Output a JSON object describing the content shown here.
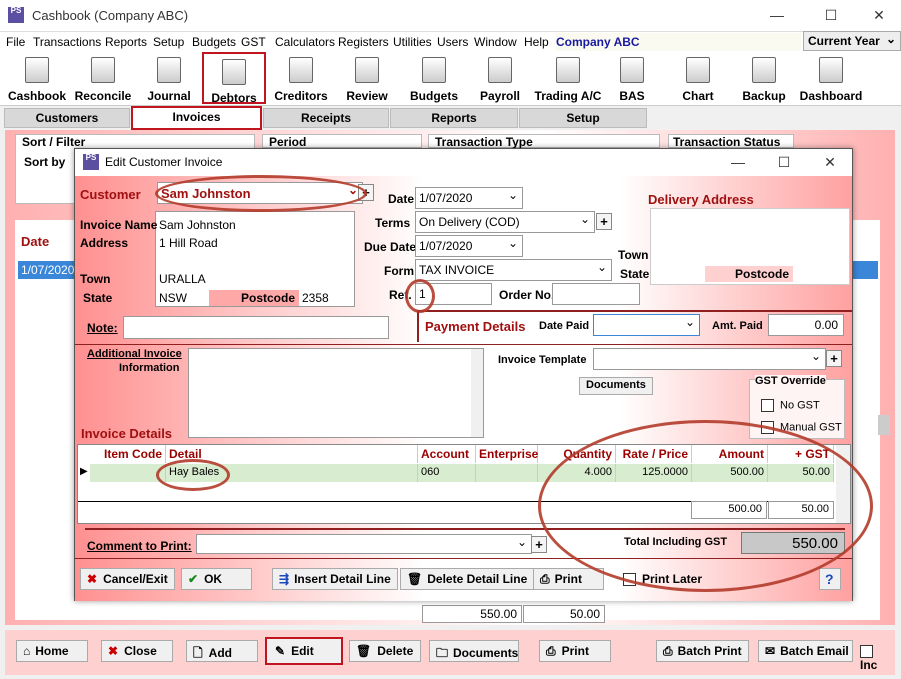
{
  "window": {
    "title": "Cashbook (Company ABC)",
    "logo": "PS"
  },
  "menu": [
    "File",
    "Transactions",
    "Reports",
    "Setup",
    "Budgets",
    "GST",
    "Calculators",
    "Registers",
    "Utilities",
    "Users",
    "Window",
    "Help"
  ],
  "company": "Company ABC",
  "year": "Current Year",
  "toolbar": [
    "Cashbook",
    "Reconcile",
    "Journal",
    "Debtors",
    "Creditors",
    "Review",
    "Budgets",
    "Payroll",
    "Trading A/C",
    "BAS",
    "Chart",
    "Backup",
    "Dashboard"
  ],
  "tabs": [
    "Customers",
    "Invoices",
    "Receipts",
    "Reports",
    "Setup"
  ],
  "bg": {
    "sort_filter": "Sort / Filter",
    "sort_by": "Sort by",
    "period": "Period",
    "transaction_type": "Transaction Type",
    "transaction_status": "Transaction Status",
    "date_header": "Date",
    "row_date": "1/07/2020",
    "total_amount": "550.00",
    "total_gst": "50.00"
  },
  "dialog": {
    "title": "Edit Customer Invoice",
    "customer_label": "Customer",
    "customer": "Sam Johnston",
    "invoice_name_label": "Invoice Name",
    "invoice_name": "Sam Johnston",
    "address_label": "Address",
    "address": "1 Hill Road",
    "town_label": "Town",
    "town": "URALLA",
    "state_label": "State",
    "state": "NSW",
    "postcode_label": "Postcode",
    "postcode": "2358",
    "note_label": "Note:",
    "date_label": "Date",
    "date": "1/07/2020",
    "terms_label": "Terms",
    "terms": "On Delivery (COD)",
    "due_date_label": "Due Date",
    "due_date": "1/07/2020",
    "form_label": "Form",
    "form": "TAX INVOICE",
    "ref_label": "Ref.",
    "ref": "1",
    "order_no_label": "Order No.",
    "delivery_title": "Delivery Address",
    "delivery_town": "Town",
    "delivery_state": "State",
    "delivery_postcode": "Postcode",
    "payment_title": "Payment Details",
    "date_paid_label": "Date Paid",
    "amt_paid_label": "Amt. Paid",
    "amt_paid": "0.00",
    "additional_label1": "Additional Invoice",
    "additional_label2": "Information",
    "template_label": "Invoice Template",
    "documents_btn": "Documents",
    "gst_override": "GST Override",
    "no_gst": "No GST",
    "manual_gst": "Manual GST",
    "details_title": "Invoice Details",
    "columns": [
      "Item Code",
      "Detail",
      "Account",
      "Enterprise",
      "Quantity",
      "Rate / Price",
      "Amount",
      "+ GST"
    ],
    "row": {
      "detail": "Hay Bales",
      "account": "060",
      "enterprise": "",
      "quantity": "4.000",
      "rate": "125.0000",
      "amount": "500.00",
      "gst": "50.00"
    },
    "sum_amount": "500.00",
    "sum_gst": "50.00",
    "comment_label": "Comment to Print:",
    "total_label": "Total Including GST",
    "total": "550.00",
    "buttons": {
      "cancel": "Cancel/Exit",
      "ok": "OK",
      "insert": "Insert Detail Line",
      "delete": "Delete Detail Line",
      "print": "Print",
      "print_later": "Print Later",
      "help": "?"
    }
  },
  "bottom": {
    "home": "Home",
    "close": "Close",
    "add": "Add",
    "edit": "Edit",
    "delete": "Delete",
    "documents": "Documents",
    "print": "Print",
    "batch_print": "Batch Print",
    "batch_email": "Batch Email",
    "inc": "Inc"
  }
}
